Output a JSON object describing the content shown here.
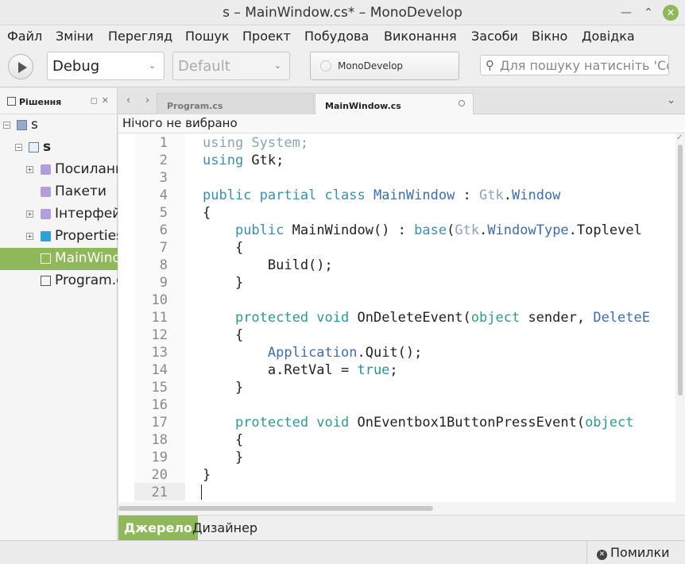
{
  "window": {
    "title": "s – MainWindow.cs* – MonoDevelop"
  },
  "menu": [
    "Файл",
    "Зміни",
    "Перегляд",
    "Пошук",
    "Проект",
    "Побудова",
    "Виконання",
    "Засоби",
    "Вікно",
    "Довідка"
  ],
  "toolbar": {
    "config": "Debug",
    "platform": "Default",
    "status": "MonoDevelop",
    "search_placeholder": "Для пошуку натисніть 'Control"
  },
  "solution_pad": {
    "title": "Рішення",
    "items": [
      {
        "label": "s",
        "icon": "solution-icon"
      },
      {
        "label": "s",
        "icon": "project-icon"
      },
      {
        "label": "Посилання",
        "icon": "references-icon"
      },
      {
        "label": "Пакети",
        "icon": "packages-icon"
      },
      {
        "label": "Інтерфейс",
        "icon": "interface-icon"
      },
      {
        "label": "Properties",
        "icon": "folder-icon"
      },
      {
        "label": "MainWindow.cs",
        "icon": "file-icon",
        "selected": true
      },
      {
        "label": "Program.cs",
        "icon": "file-icon"
      }
    ]
  },
  "tabs": [
    {
      "label": "Program.cs",
      "active": false
    },
    {
      "label": "MainWindow.cs",
      "active": true
    }
  ],
  "pathbar": {
    "text": "Нічого не вибрано"
  },
  "code": {
    "line_numbers": [
      "1",
      "2",
      "3",
      "4",
      "5",
      "6",
      "7",
      "8",
      "9",
      "10",
      "11",
      "12",
      "13",
      "14",
      "15",
      "16",
      "17",
      "18",
      "19",
      "20",
      "21"
    ]
  },
  "bottom_tabs": {
    "source": "Джерело",
    "designer": "Дизайнер"
  },
  "statusbar": {
    "errors": "Помилки"
  },
  "colors": {
    "accent": "#8fb85a"
  }
}
